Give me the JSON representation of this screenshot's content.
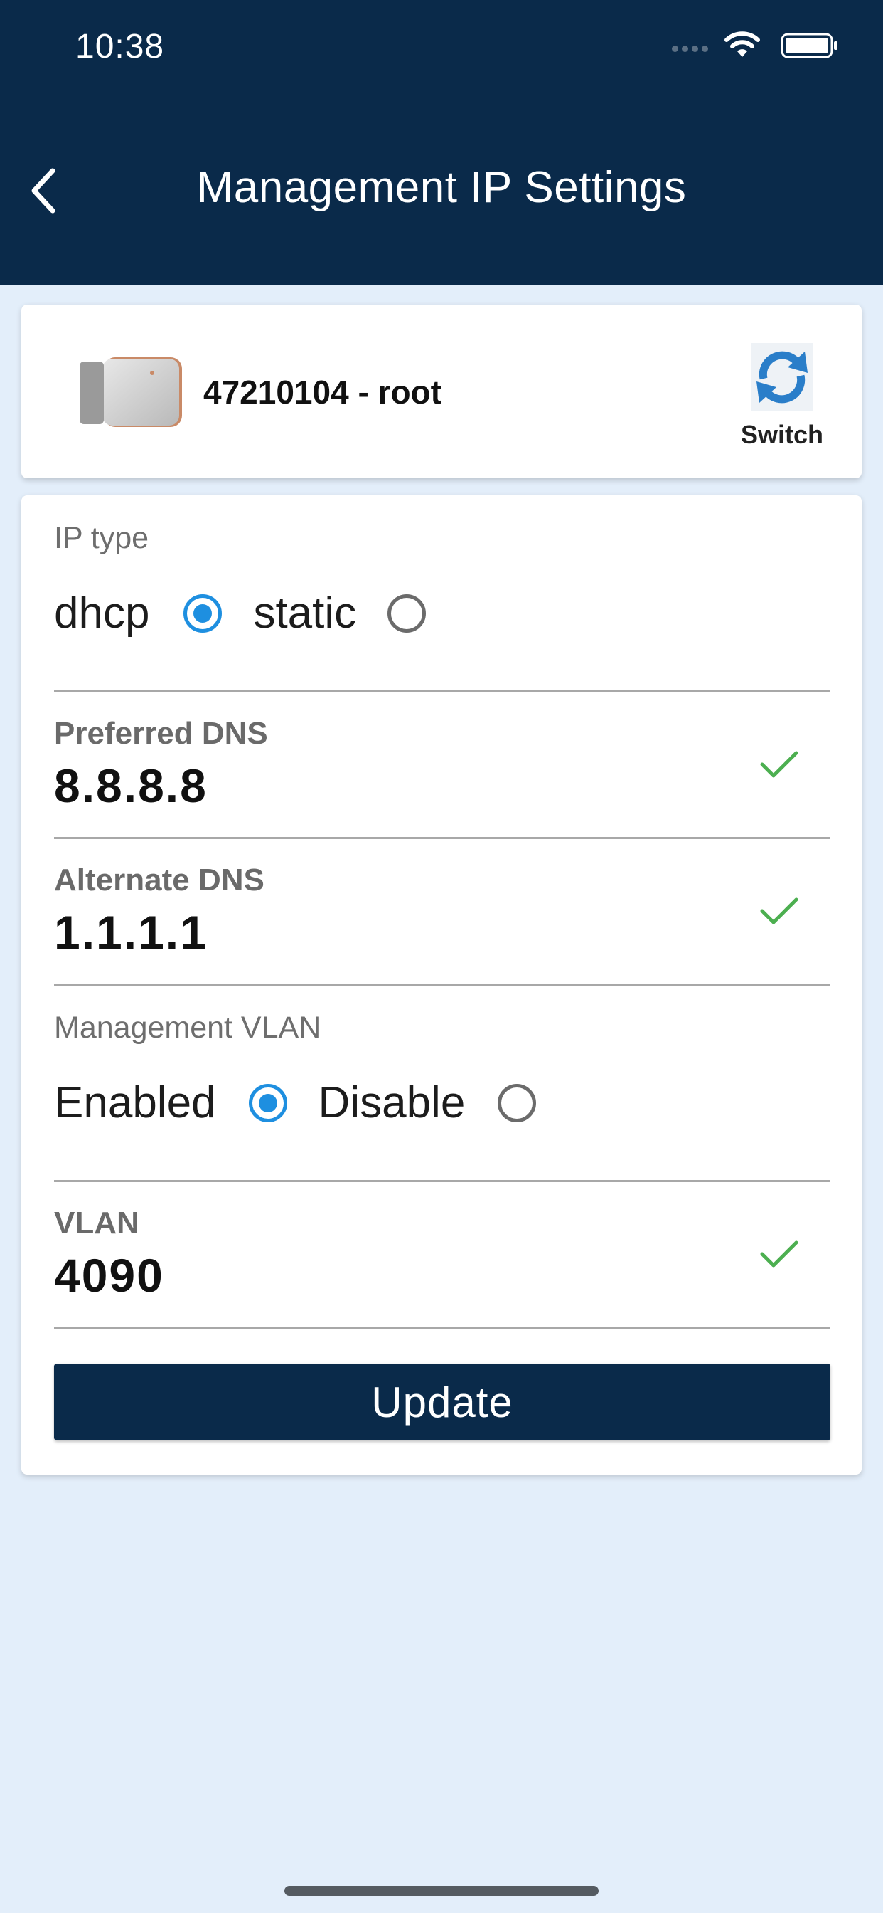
{
  "status_bar": {
    "time": "10:38"
  },
  "header": {
    "title": "Management IP Settings",
    "back_icon": "chevron-left-icon"
  },
  "device": {
    "name": "47210104 - root",
    "switch_label": "Switch"
  },
  "ip_type": {
    "label": "IP type",
    "options": [
      "dhcp",
      "static"
    ],
    "selected": "dhcp"
  },
  "preferred_dns": {
    "label": "Preferred DNS",
    "value": "8.8.8.8",
    "valid": true
  },
  "alternate_dns": {
    "label": "Alternate DNS",
    "value": "1.1.1.1",
    "valid": true
  },
  "management_vlan": {
    "label": "Management VLAN",
    "options": [
      "Enabled",
      "Disable"
    ],
    "selected": "Enabled"
  },
  "vlan": {
    "label": "VLAN",
    "value": "4090",
    "valid": true
  },
  "actions": {
    "update_label": "Update"
  },
  "colors": {
    "header_bg": "#0a2a4a",
    "accent": "#1e8fe0",
    "check": "#4caf50",
    "page_bg": "#e3eefa"
  }
}
